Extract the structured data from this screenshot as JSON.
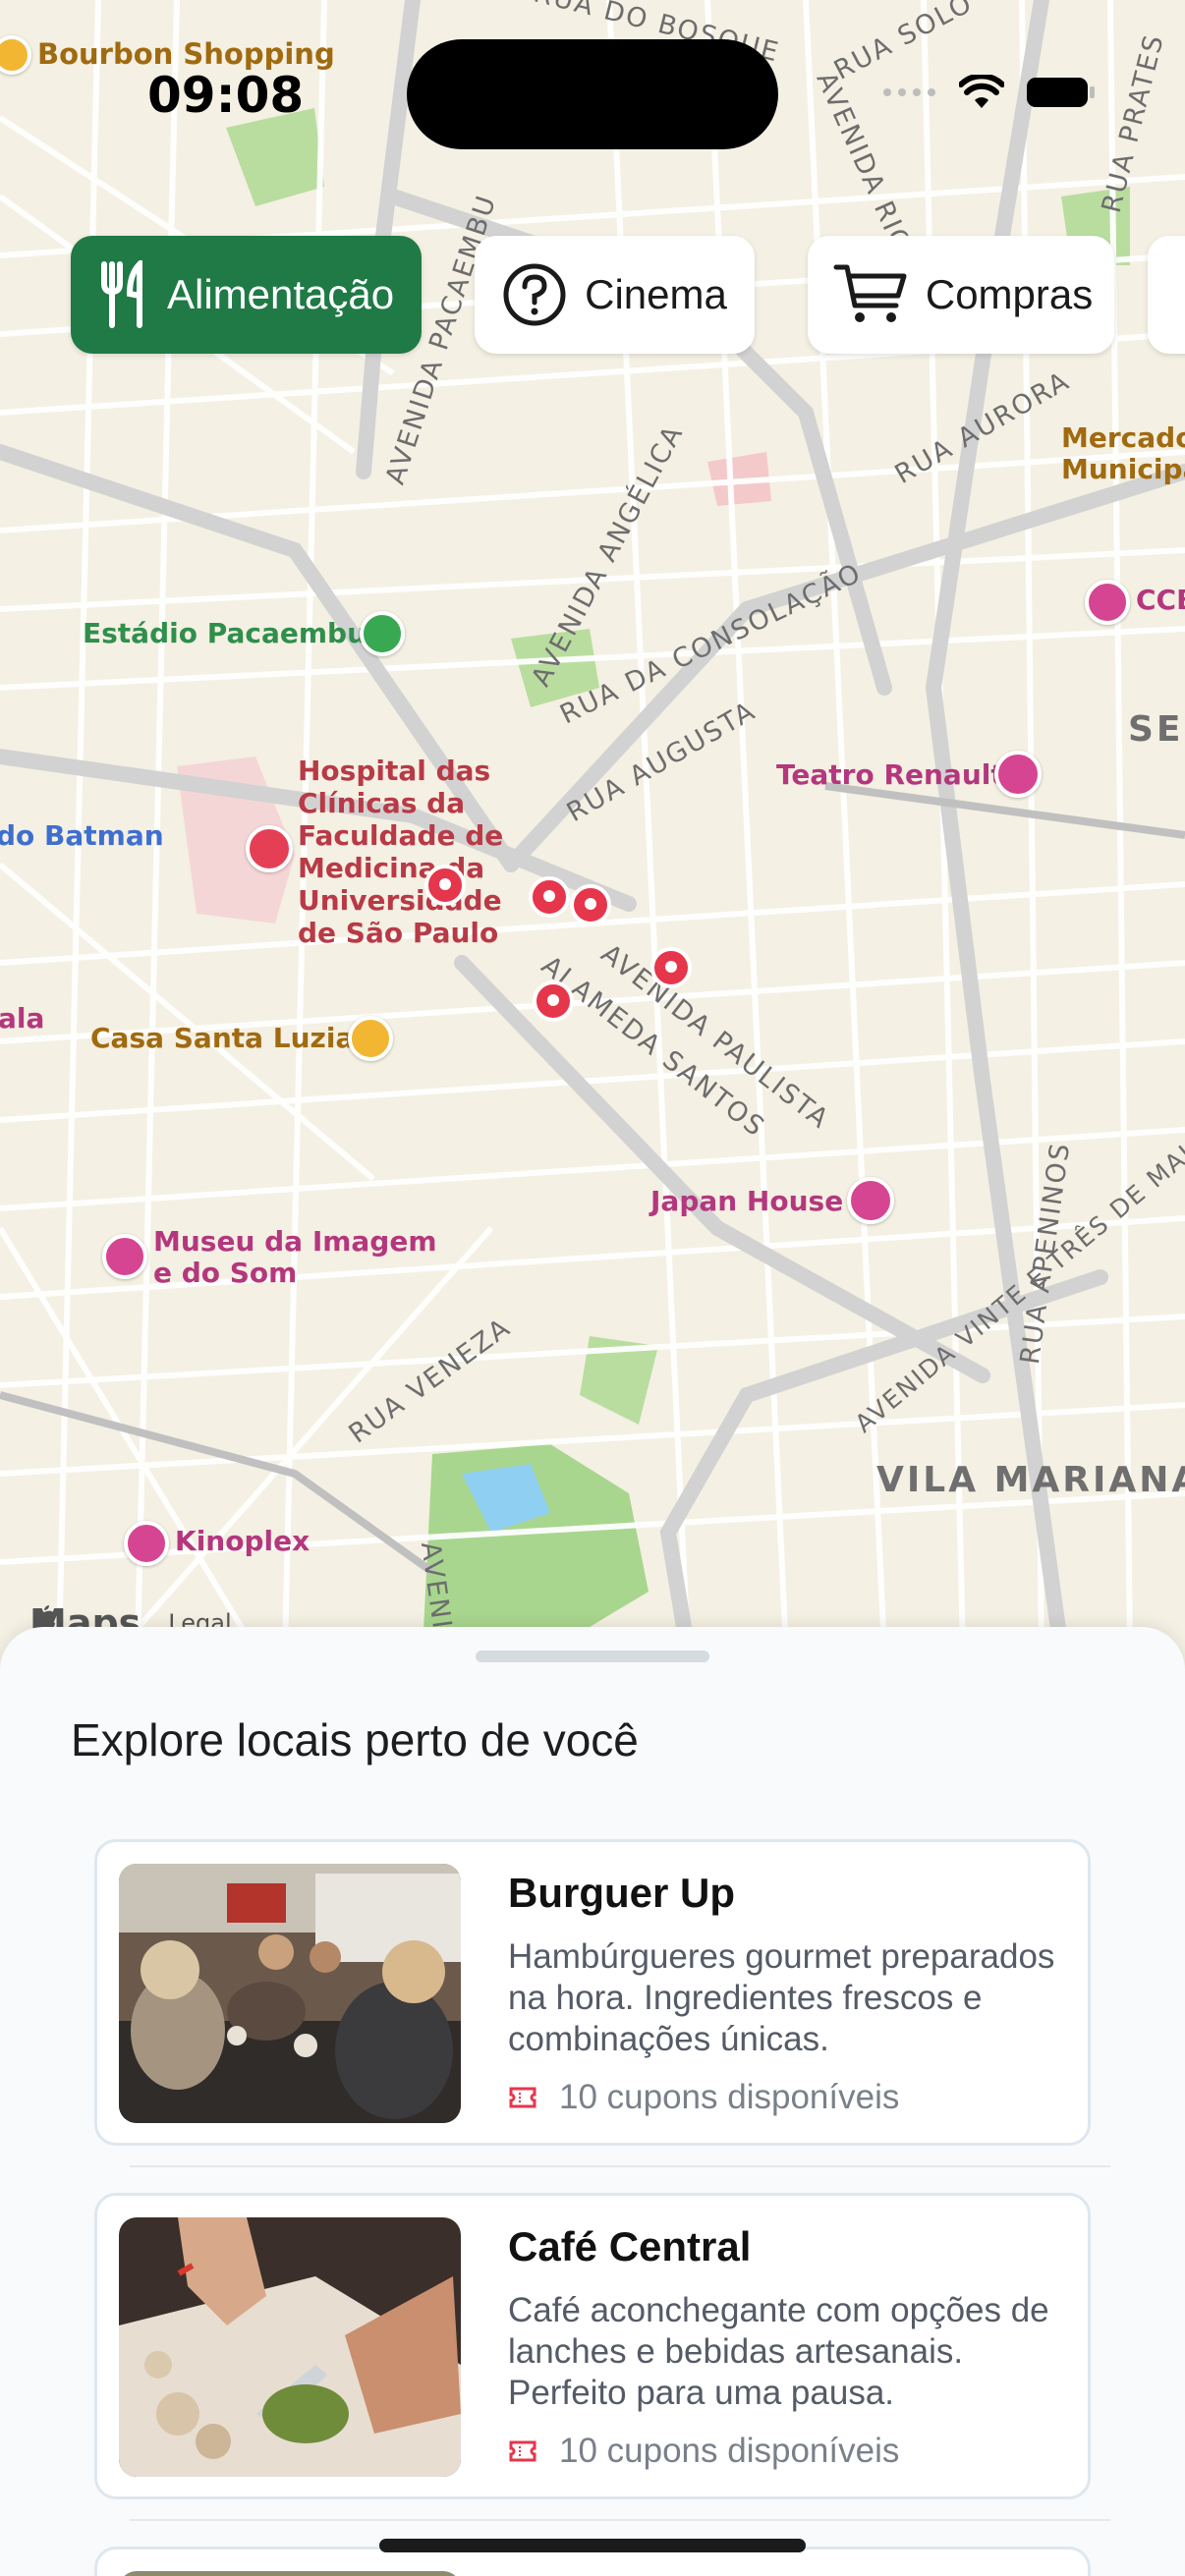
{
  "status_bar": {
    "time": "09:08"
  },
  "map": {
    "streets": [
      "RUA DO BOSQUE",
      "RUA SOLO",
      "RUA PRATES",
      "AVENIDA RIO",
      "AVENIDA PACAEMBU",
      "AVENIDA ANGÉLICA",
      "RUA AURORA",
      "RUA DA CONSOLAÇÃO",
      "RUA AUGUSTA",
      "AVENIDA PAULISTA",
      "ALAMEDA SANTOS",
      "RUA VENEZA",
      "AVENIDA VINTE E TRÊS DE MAIO",
      "RUA APENINOS",
      "AVENIDA"
    ],
    "pois": {
      "bourbon": "Bourbon Shopping",
      "pacaembu": "Estádio Pacaembu",
      "hospital": "Hospital das Clínicas da Faculdade de Medicina da Universidade de São Paulo",
      "batman": "do Batman",
      "casa_santa_luzia": "Casa Santa Luzia",
      "museu": "Museu da Imagem e do Som",
      "kinoplex": "Kinoplex",
      "teatro": "Teatro Renault",
      "japan_house": "Japan House",
      "mercado": "Mercado Municipal",
      "ccbb": "CCB",
      "se": "SE",
      "ala": "ala",
      "vila_mariana": "VILA MARIANA"
    },
    "attribution": {
      "maps": "Maps",
      "legal": "Legal"
    }
  },
  "categories": [
    {
      "label": "Alimentação",
      "icon": "utensils-icon",
      "active": true
    },
    {
      "label": "Cinema",
      "icon": "question-circle-icon",
      "active": false
    },
    {
      "label": "Compras",
      "icon": "cart-icon",
      "active": false
    }
  ],
  "sheet": {
    "title": "Explore locais perto de você",
    "places": [
      {
        "name": "Burguer Up",
        "description": "Hambúrgueres gourmet preparados na hora. Ingredientes frescos e combinações únicas.",
        "coupons": "10 cupons disponíveis"
      },
      {
        "name": "Café Central",
        "description": "Café aconchegante com opções de lanches e bebidas artesanais. Perfeito para uma pausa.",
        "coupons": "10 cupons disponíveis"
      }
    ]
  },
  "colors": {
    "accent_green": "#1f7a46",
    "pin_red": "#e5364b",
    "map_bg": "#f4f0e3",
    "park_green": "#a8d68e",
    "water_blue": "#8fd0f2"
  }
}
